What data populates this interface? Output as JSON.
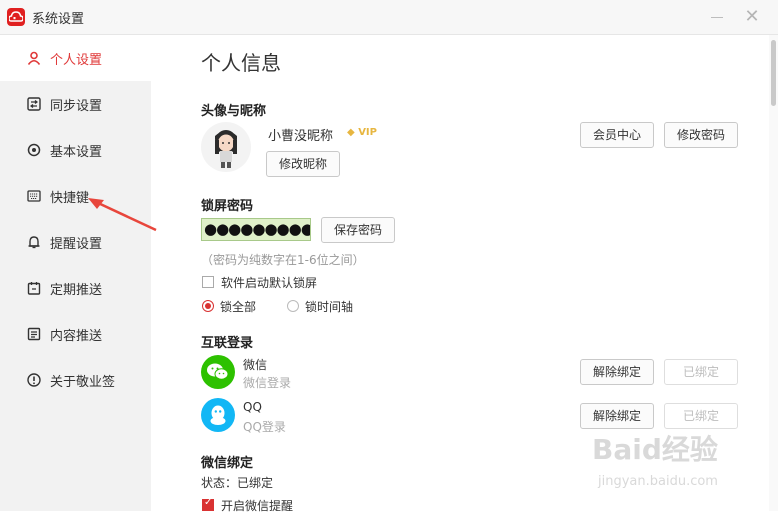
{
  "window": {
    "title": "系统设置",
    "minimize_icon": "minimize-icon",
    "close_icon": "close-icon",
    "close_glyph": "✕"
  },
  "sidebar": {
    "items": [
      {
        "label": "个人设置",
        "icon": "user-icon",
        "active": true
      },
      {
        "label": "同步设置",
        "icon": "sync-icon"
      },
      {
        "label": "基本设置",
        "icon": "settings-icon"
      },
      {
        "label": "快捷键",
        "icon": "keyboard-icon"
      },
      {
        "label": "提醒设置",
        "icon": "bell-icon"
      },
      {
        "label": "定期推送",
        "icon": "calendar-icon"
      },
      {
        "label": "内容推送",
        "icon": "document-icon"
      },
      {
        "label": "关于敬业签",
        "icon": "info-icon"
      }
    ]
  },
  "main": {
    "page_title": "个人信息",
    "profile": {
      "section_title": "头像与昵称",
      "nickname": "小曹没昵称",
      "vip_badge": "VIP",
      "edit_nickname_button": "修改昵称",
      "member_center_button": "会员中心",
      "change_password_button": "修改密码"
    },
    "lock_password": {
      "section_title": "锁屏密码",
      "password_value": "●●●●●●●●●",
      "save_button": "保存密码",
      "hint": "（密码为纯数字在1-6位之间）",
      "auto_lock_label": "软件启动默认锁屏",
      "auto_lock_checked": false,
      "lock_options": [
        {
          "label": "锁全部",
          "selected": true
        },
        {
          "label": "锁时间轴",
          "selected": false
        }
      ]
    },
    "linked_login": {
      "section_title": "互联登录",
      "accounts": [
        {
          "name": "微信",
          "sub": "微信登录",
          "unbind_button": "解除绑定",
          "status_button": "已绑定",
          "icon": "wechat-icon",
          "color": "#2dc100"
        },
        {
          "name": "QQ",
          "sub": "QQ登录",
          "unbind_button": "解除绑定",
          "status_button": "已绑定",
          "icon": "qq-icon",
          "color": "#12b7f5"
        }
      ]
    },
    "wechat_binding": {
      "section_title": "微信绑定",
      "status_text": "状态：已绑定",
      "reminder_label": "开启微信提醒",
      "reminder_checked": true
    }
  },
  "watermark": {
    "main": "Baid经验",
    "sub": "jingyan.baidu.com"
  },
  "colors": {
    "accent": "#e03a3a",
    "sidebar_bg": "#f2f2f2",
    "arrow": "#e8463c"
  }
}
